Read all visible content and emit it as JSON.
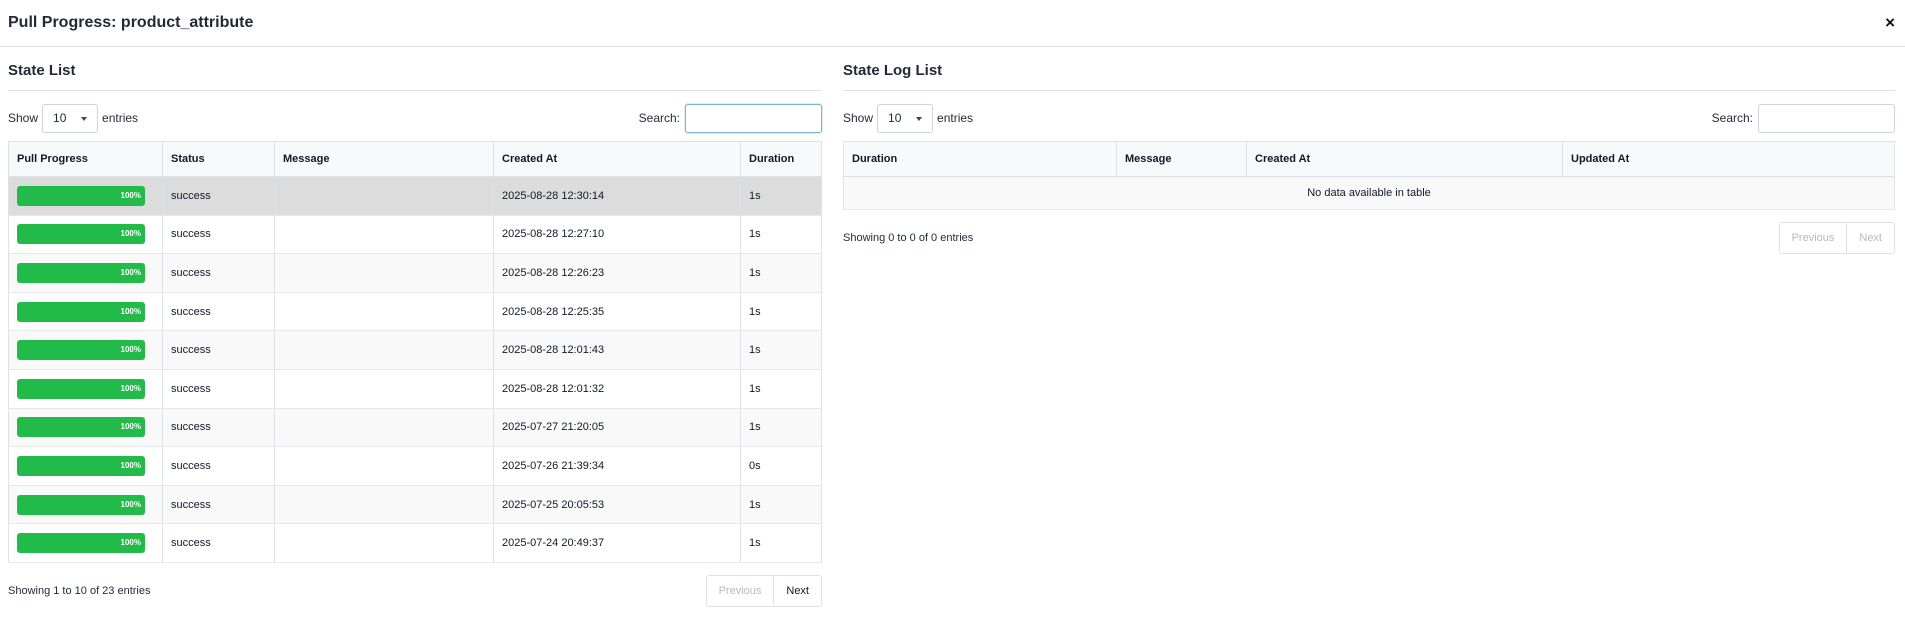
{
  "modal": {
    "title": "Pull Progress: product_attribute",
    "close_label": "×"
  },
  "state_list": {
    "title": "State List",
    "length": {
      "show_label": "Show",
      "value": "10",
      "entries_label": "entries"
    },
    "search": {
      "label": "Search:",
      "value": ""
    },
    "columns": [
      "Pull Progress",
      "Status",
      "Message",
      "Created At",
      "Duration"
    ],
    "rows": [
      {
        "progress": "100%",
        "status": "success",
        "message": "",
        "created_at": "2025-08-28 12:30:14",
        "duration": "1s"
      },
      {
        "progress": "100%",
        "status": "success",
        "message": "",
        "created_at": "2025-08-28 12:27:10",
        "duration": "1s"
      },
      {
        "progress": "100%",
        "status": "success",
        "message": "",
        "created_at": "2025-08-28 12:26:23",
        "duration": "1s"
      },
      {
        "progress": "100%",
        "status": "success",
        "message": "",
        "created_at": "2025-08-28 12:25:35",
        "duration": "1s"
      },
      {
        "progress": "100%",
        "status": "success",
        "message": "",
        "created_at": "2025-08-28 12:01:43",
        "duration": "1s"
      },
      {
        "progress": "100%",
        "status": "success",
        "message": "",
        "created_at": "2025-08-28 12:01:32",
        "duration": "1s"
      },
      {
        "progress": "100%",
        "status": "success",
        "message": "",
        "created_at": "2025-07-27 21:20:05",
        "duration": "1s"
      },
      {
        "progress": "100%",
        "status": "success",
        "message": "",
        "created_at": "2025-07-26 21:39:34",
        "duration": "0s"
      },
      {
        "progress": "100%",
        "status": "success",
        "message": "",
        "created_at": "2025-07-25 20:05:53",
        "duration": "1s"
      },
      {
        "progress": "100%",
        "status": "success",
        "message": "",
        "created_at": "2025-07-24 20:49:37",
        "duration": "1s"
      }
    ],
    "info": "Showing 1 to 10 of 23 entries",
    "previous_label": "Previous",
    "next_label": "Next"
  },
  "state_log_list": {
    "title": "State Log List",
    "length": {
      "show_label": "Show",
      "value": "10",
      "entries_label": "entries"
    },
    "search": {
      "label": "Search:",
      "value": ""
    },
    "columns": [
      "Duration",
      "Message",
      "Created At",
      "Updated At"
    ],
    "empty_text": "No data available in table",
    "info": "Showing 0 to 0 of 0 entries",
    "previous_label": "Previous",
    "next_label": "Next"
  },
  "colors": {
    "progress_bar": "#22bb4a",
    "active_row": "#dcdcdc",
    "border": "#dee2e6"
  }
}
